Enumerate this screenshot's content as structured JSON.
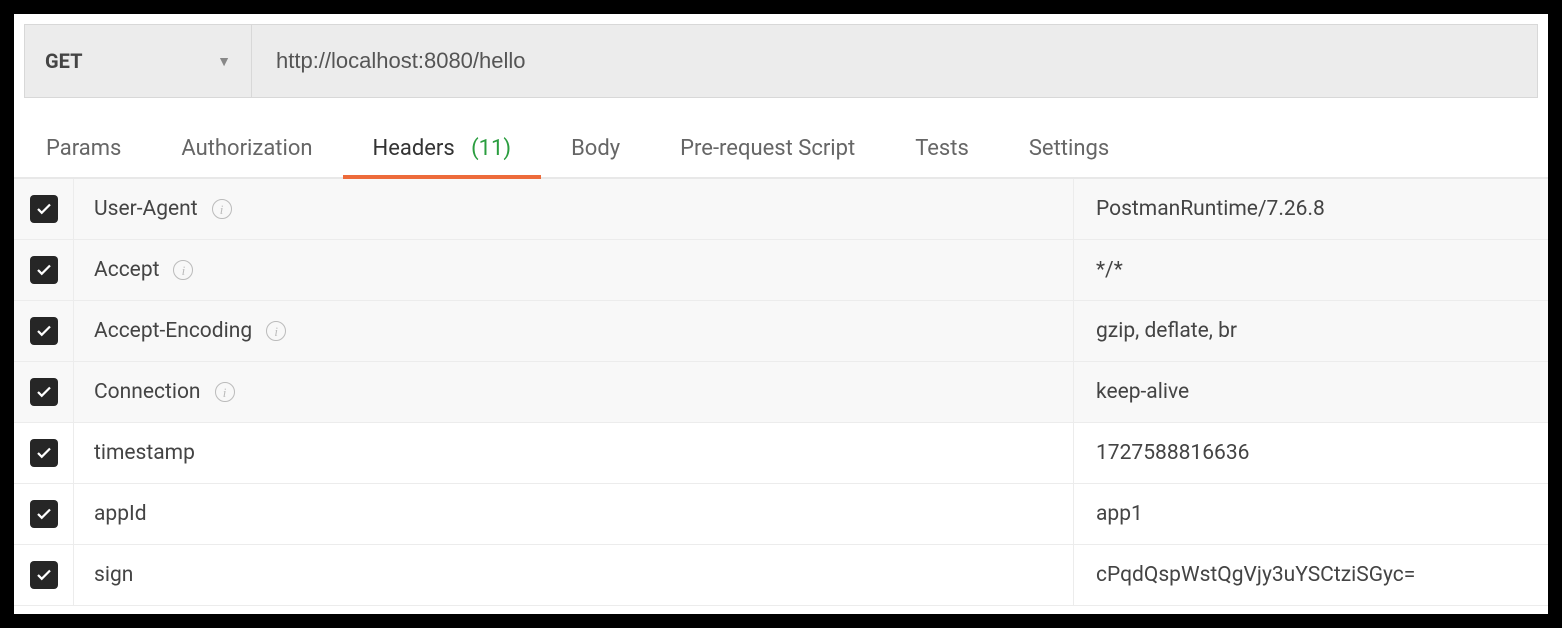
{
  "request": {
    "method": "GET",
    "url": "http://localhost:8080/hello"
  },
  "tabs": {
    "params": "Params",
    "authorization": "Authorization",
    "headers_label": "Headers",
    "headers_count": "(11)",
    "body": "Body",
    "prerequest": "Pre-request Script",
    "tests": "Tests",
    "settings": "Settings"
  },
  "headers": [
    {
      "enabled": true,
      "autogen": true,
      "key": "User-Agent",
      "value": "PostmanRuntime/7.26.8"
    },
    {
      "enabled": true,
      "autogen": true,
      "key": "Accept",
      "value": "*/*"
    },
    {
      "enabled": true,
      "autogen": true,
      "key": "Accept-Encoding",
      "value": "gzip, deflate, br"
    },
    {
      "enabled": true,
      "autogen": true,
      "key": "Connection",
      "value": "keep-alive"
    },
    {
      "enabled": true,
      "autogen": false,
      "key": "timestamp",
      "value": "1727588816636"
    },
    {
      "enabled": true,
      "autogen": false,
      "key": "appId",
      "value": "app1"
    },
    {
      "enabled": true,
      "autogen": false,
      "key": "sign",
      "value": "cPqdQspWstQgVjy3uYSCtziSGyc="
    }
  ]
}
